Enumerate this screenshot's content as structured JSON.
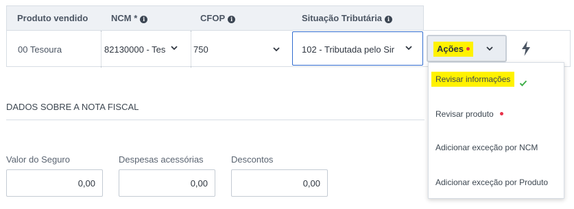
{
  "table": {
    "headers": {
      "produto": "Produto vendido",
      "ncm": "NCM *",
      "cfop": "CFOP",
      "situacao": "Situação Tributária"
    },
    "row": {
      "produto": "00 Tesoura",
      "ncm": "82130000 - Tes",
      "cfop": "750",
      "situacao": "102 - Tributada pelo Sir"
    }
  },
  "actions": {
    "label": "Ações",
    "has_alert": true
  },
  "menu": {
    "items": [
      {
        "label": "Revisar informações",
        "highlighted": true,
        "status": "check"
      },
      {
        "label": "Revisar produto",
        "highlighted": false,
        "status": "alert-dot"
      },
      {
        "label": "Adicionar exceção por NCM",
        "highlighted": false,
        "status": ""
      },
      {
        "label": "Adicionar exceção por Produto",
        "highlighted": false,
        "status": ""
      }
    ]
  },
  "section": {
    "title": "DADOS SOBRE A NOTA FISCAL"
  },
  "fields": {
    "seguro": {
      "label": "Valor do Seguro",
      "value": "0,00"
    },
    "despesas": {
      "label": "Despesas acessórias",
      "value": "0,00"
    },
    "descontos": {
      "label": "Descontos",
      "value": "0,00"
    }
  },
  "colors": {
    "highlight": "#fff200",
    "alert": "#e8324a",
    "check": "#3fae49",
    "focus_border": "#2f6bcf",
    "header_bg": "#eef1f5"
  },
  "icons": {
    "info": "info-icon",
    "chevron": "chevron-down-icon",
    "bolt": "lightning-icon",
    "check": "check-icon"
  }
}
